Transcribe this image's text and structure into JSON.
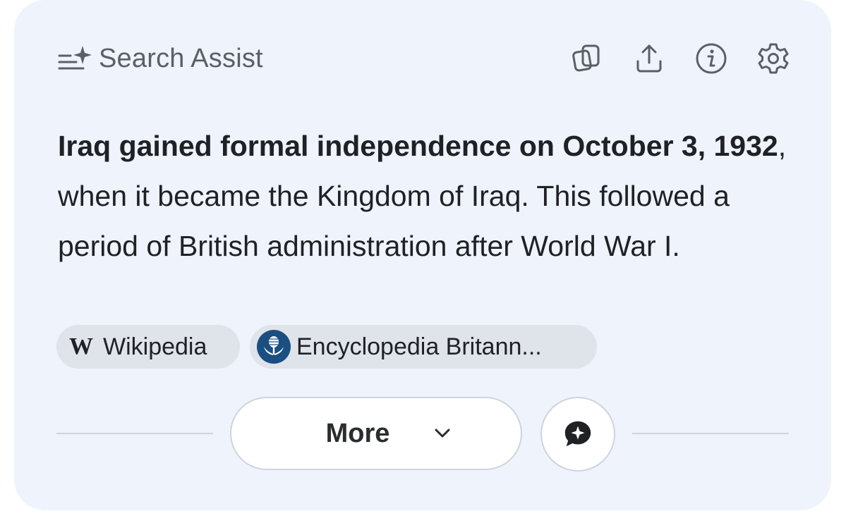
{
  "header": {
    "title": "Search Assist",
    "icons": [
      "sparkle-list-icon",
      "copy-icon",
      "share-icon",
      "info-icon",
      "gear-icon"
    ]
  },
  "answer": {
    "bold_part": "Iraq gained formal independence on October 3, 1932",
    "rest_part": ", when it became the Kingdom of Iraq. This followed a period of British administration after World War I."
  },
  "sources": [
    {
      "logo_text": "W",
      "label": "Wikipedia"
    },
    {
      "logo_icon": "britannica-thistle-icon",
      "label": "Encyclopedia Britann..."
    }
  ],
  "footer": {
    "more_label": "More",
    "more_icon": "chevron-down-icon",
    "chat_icon": "chat-sparkle-icon"
  },
  "colors": {
    "card_bg": "#eef3fc",
    "chip_bg": "#dfe3ea",
    "britannica_blue": "#1b4f82",
    "text": "#1f2125",
    "muted": "#5b5f66"
  }
}
